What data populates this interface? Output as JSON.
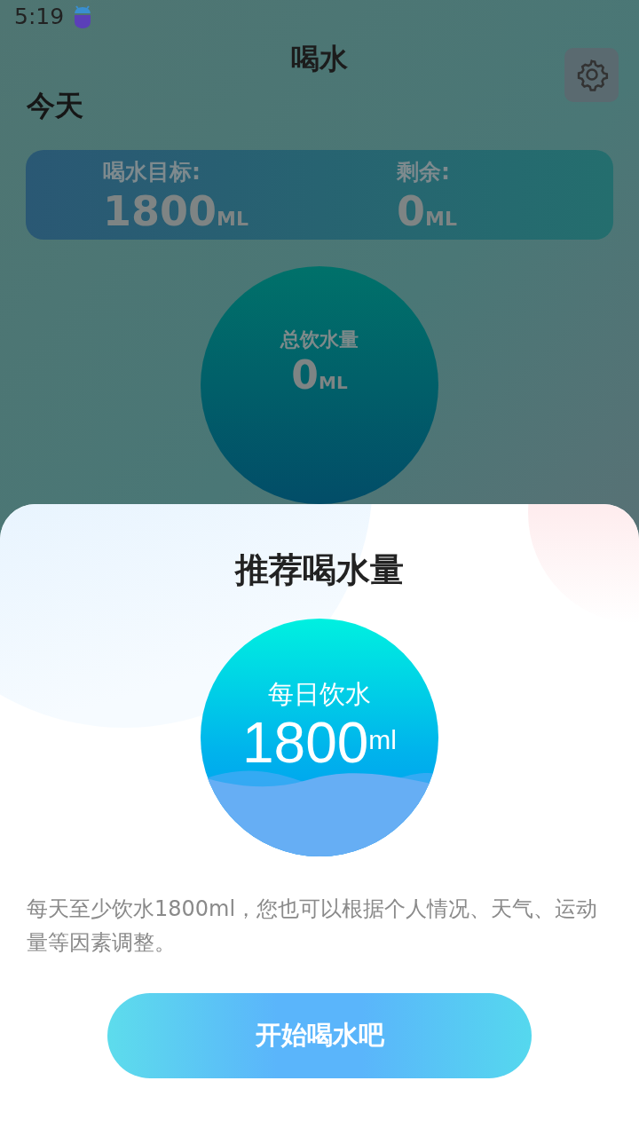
{
  "status_bar": {
    "time": "5:19"
  },
  "header": {
    "title": "喝水"
  },
  "today": {
    "heading": "今天",
    "stats": [
      {
        "label": "喝水目标:",
        "value": "1800",
        "unit": "ML"
      },
      {
        "label": "剩余:",
        "value": "0",
        "unit": "ML"
      }
    ],
    "total": {
      "label": "总饮水量",
      "value": "0",
      "unit": "ML"
    }
  },
  "sheet": {
    "title": "推荐喝水量",
    "circle_label": "每日饮水",
    "amount": "1800",
    "unit": "ml",
    "description": "每天至少饮水1800ml，您也可以根据个人情况、天气、运动量等因素调整。",
    "button": "开始喝水吧"
  }
}
